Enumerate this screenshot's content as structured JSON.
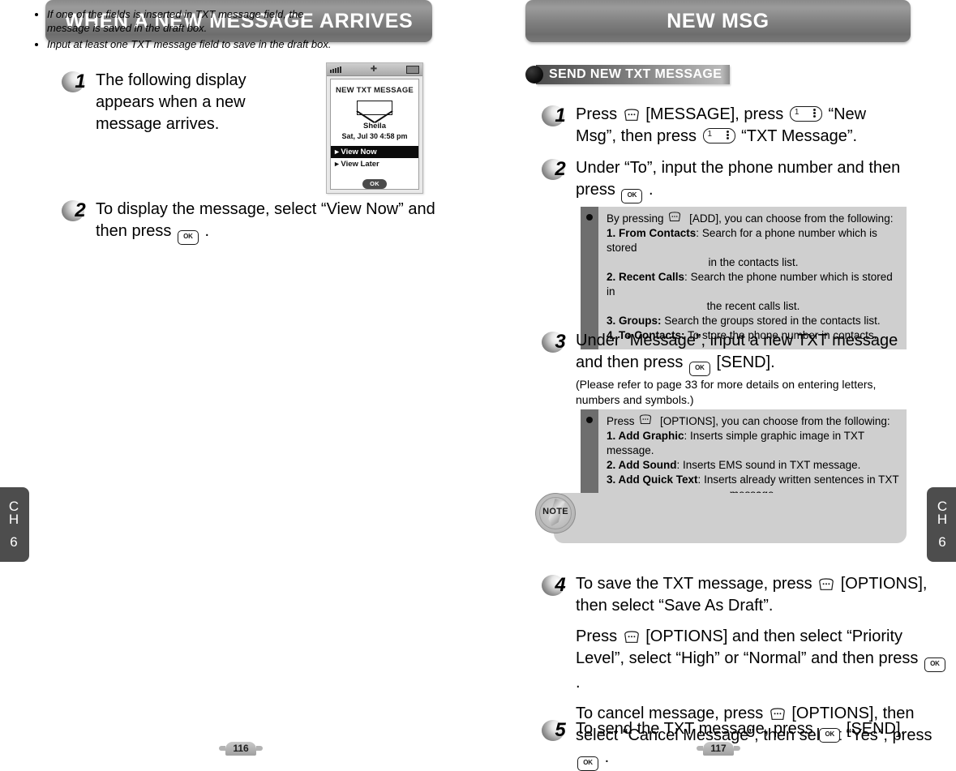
{
  "spread": {
    "left_page": {
      "page_number": "116",
      "title": "WHEN A NEW MESSAGE ARRIVES",
      "chapter_tab": {
        "line1": "C",
        "line2": "H",
        "number": "6"
      },
      "steps": [
        {
          "number": "1",
          "text_parts": [
            "The following display appears when a new message arrives."
          ]
        },
        {
          "number": "2",
          "pre": "To display the message, select “View Now” and then press",
          "key": "ok-key-icon",
          "post": "."
        }
      ],
      "phone_screenshot": {
        "status_icons": [
          "signal-bars-icon",
          "roaming-icon",
          "battery-icon"
        ],
        "lcd_title": "NEW TXT MESSAGE",
        "icon": "envelope-icon",
        "sender": "Sheila",
        "datetime": "Sat, Jul 30  4:58 pm",
        "menu": [
          {
            "label": "▸ View Now",
            "selected": true
          },
          {
            "label": "▸ View Later",
            "selected": false
          }
        ],
        "softkey": "OK"
      }
    },
    "right_page": {
      "page_number": "117",
      "title": "NEW MSG",
      "chapter_tab": {
        "line1": "C",
        "line2": "H",
        "number": "6"
      },
      "section_header": "SEND NEW TXT MESSAGE",
      "steps": [
        {
          "number": "1",
          "line1_a": "Press",
          "line1_key": "softkey-icon",
          "line1_b": "[MESSAGE], press",
          "line1_key2": "one-key-icon",
          "line1_c": "“New Msg”,",
          "line2_a": "then press",
          "line2_key": "one-key-icon",
          "line2_b": "“TXT Message”."
        },
        {
          "number": "2",
          "line1": "Under “To”, input the phone number and then",
          "line2_a": "press",
          "line2_key": "ok-key-icon",
          "line2_b": "."
        },
        {
          "number": "3",
          "line1": "Under “Message”, input a new TXT message",
          "line2_a": "and then press",
          "line2_key": "ok-key-icon",
          "line2_b": "[SEND].",
          "note": "(Please refer to page 33 for more details on entering letters, numbers and symbols.)"
        },
        {
          "number": "4",
          "para1_a": "To save the TXT message, press",
          "para1_key": "softkey-icon",
          "para1_b": "[OPTIONS], then select “Save As Draft”.",
          "para2_a": "Press",
          "para2_key": "softkey-icon",
          "para2_b": "[OPTIONS] and then select “Priority Level”, select “High” or “Normal” and then press",
          "para2_key2": "ok-key-icon",
          "para2_c": ".",
          "para3_a": "To cancel message, press",
          "para3_key": "softkey-icon",
          "para3_b": "[OPTIONS], then select “Cancel Message”, then select “Yes”, press",
          "para3_key2": "ok-key-icon",
          "para3_c": "."
        },
        {
          "number": "5",
          "line1_a": "To send the TXT message, press",
          "line1_key": "ok-key-icon",
          "line1_b": "[SEND]."
        }
      ],
      "info_box_1": {
        "bullet": "bullet-icon",
        "lead_a": "By pressing",
        "lead_key": "softkey-icon",
        "lead_b": "[ADD], you can choose from the following:",
        "items": [
          {
            "label": "1. From Contacts",
            "sep": ":",
            "desc": "Search for a phone number which is stored",
            "cont": "in the contacts list."
          },
          {
            "label": "2. Recent Calls",
            "sep": ":",
            "desc": "Search the phone number which is stored in",
            "cont": "the recent calls list."
          },
          {
            "label": "3. Groups:",
            "sep": "",
            "desc": "Search the groups stored in the contacts list.",
            "cont": ""
          },
          {
            "label": "4. To Contacts:",
            "sep": "",
            "desc": "To store the phone number in contacts.",
            "cont": ""
          }
        ]
      },
      "info_box_2": {
        "bullet": "bullet-icon",
        "lead_a": "Press",
        "lead_key": "softkey-icon",
        "lead_b": "[OPTIONS], you can choose from the following:",
        "items": [
          {
            "label": "1. Add Graphic",
            "sep": ":",
            "desc": "Inserts simple graphic image in TXT message.",
            "cont": ""
          },
          {
            "label": "2. Add Sound",
            "sep": ":",
            "desc": "Inserts EMS sound in TXT message.",
            "cont": ""
          },
          {
            "label": "3. Add Quick Text",
            "sep": ":",
            "desc": "Inserts already written sentences in TXT",
            "cont": "message."
          }
        ]
      },
      "note_box": {
        "badge": "NOTE",
        "bullets": [
          "If one of the fields is inserted in TXT message field, the message is saved in the draft box.",
          "Input at least one TXT message field to save in the draft box."
        ]
      }
    }
  },
  "colors": {
    "title_bar_dark": "#6d6d6d",
    "title_bar_light": "#9b9b9b",
    "info_box_bg": "#cfcfcf",
    "info_box_bar": "#6e6e6e",
    "chapter_tab": "#4d4d4d",
    "lcd_highlight": "#0b0b0b"
  }
}
